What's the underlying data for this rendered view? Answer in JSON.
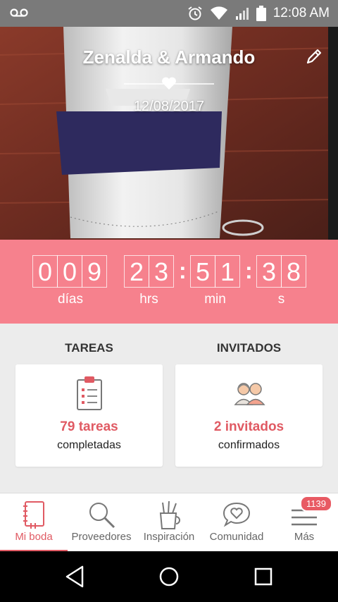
{
  "status_bar": {
    "time": "12:08 AM"
  },
  "hero": {
    "couple_names": "Zenalda & Armando",
    "wedding_date": "12/08/2017"
  },
  "countdown": {
    "days_digits": [
      "0",
      "0",
      "9"
    ],
    "hours_digits": [
      "2",
      "3"
    ],
    "minutes_digits": [
      "5",
      "1"
    ],
    "seconds_digits": [
      "3",
      "8"
    ],
    "separator": ":",
    "labels": {
      "days": "días",
      "hours": "hrs",
      "minutes": "min",
      "seconds": "s"
    }
  },
  "tasks": {
    "title": "TAREAS",
    "count": "79 tareas",
    "sub": "completadas"
  },
  "guests": {
    "title": "INVITADOS",
    "count": "2 invitados",
    "sub": "confirmados"
  },
  "bottom_nav": {
    "items": [
      {
        "label": "Mi boda",
        "icon": "notebook-icon",
        "active": true
      },
      {
        "label": "Proveedores",
        "icon": "search-icon"
      },
      {
        "label": "Inspiración",
        "icon": "pencil-cup-icon"
      },
      {
        "label": "Comunidad",
        "icon": "chat-heart-icon"
      },
      {
        "label": "Más",
        "icon": "menu-icon",
        "badge": "1139"
      }
    ]
  },
  "colors": {
    "accent": "#f6818d",
    "accent_text": "#e05a63"
  }
}
